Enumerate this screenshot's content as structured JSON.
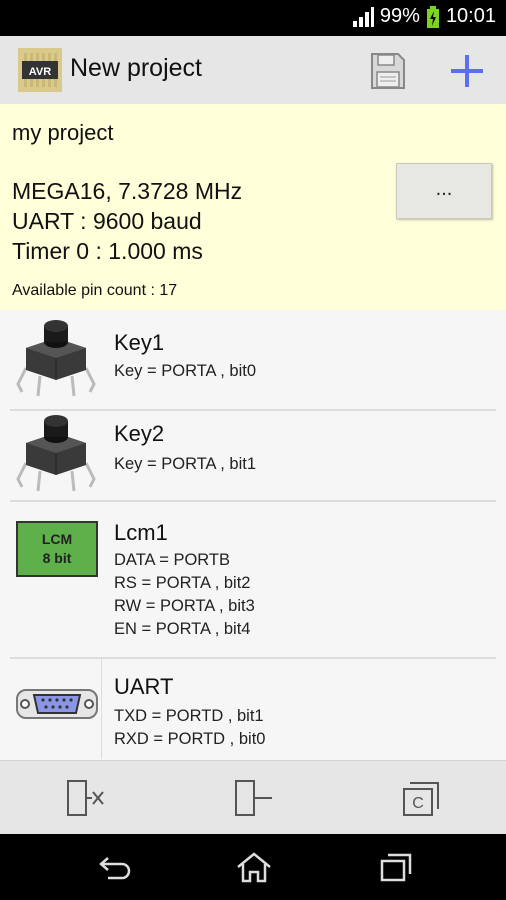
{
  "status": {
    "battery": "99%",
    "time": "10:01"
  },
  "app": {
    "icon_label": "AVR",
    "title": "New project"
  },
  "project": {
    "name": "my project",
    "mcu": "MEGA16, 7.3728 MHz",
    "uart": "UART : 9600 baud",
    "timer": "Timer 0 : 1.000 ms",
    "pin_count": "Available pin count : 17",
    "more_button": "..."
  },
  "components": [
    {
      "title": "Key1",
      "lines": [
        "Key = PORTA , bit0"
      ],
      "icon": "push-button-icon"
    },
    {
      "title": "Key2",
      "lines": [
        "Key = PORTA , bit1"
      ],
      "icon": "push-button-icon"
    },
    {
      "title": "Lcm1",
      "lcd_line1": "LCM",
      "lcd_line2": "8 bit",
      "lines": [
        "DATA = PORTB",
        "RS = PORTA , bit2",
        "RW = PORTA , bit3",
        "EN = PORTA , bit4"
      ],
      "icon": "lcm-icon"
    },
    {
      "title": "UART",
      "lines": [
        "TXD = PORTD , bit1",
        "RXD = PORTD , bit0"
      ],
      "icon": "db9-connector-icon"
    }
  ],
  "bottom_actions": {
    "copy_label": "C"
  },
  "colors": {
    "info_bg": "#ffffd9",
    "accent": "#5b6ef5",
    "lcm_green": "#5eb04a"
  }
}
